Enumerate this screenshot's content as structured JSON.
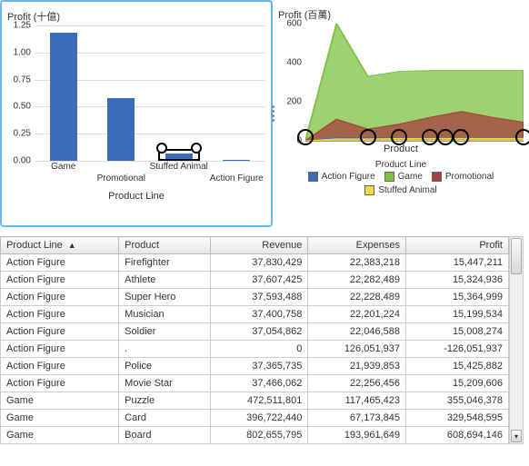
{
  "chart_data": [
    {
      "type": "bar",
      "title": "Profit (十億)",
      "xlabel": "Product Line",
      "ylabel": "",
      "ylim": [
        0,
        1.25
      ],
      "yticks": [
        0.0,
        0.25,
        0.5,
        0.75,
        1.0,
        1.25
      ],
      "categories": [
        "Game",
        "Promotional",
        "Stuffed Animal",
        "Action Figure"
      ],
      "values": [
        1.18,
        0.58,
        0.07,
        0.01
      ],
      "selected_category": "Stuffed Animal"
    },
    {
      "type": "area",
      "title": "Profit (百萬)",
      "xlabel": "Product",
      "ylabel": "",
      "ylim": [
        0,
        600
      ],
      "yticks": [
        0,
        200,
        400,
        600
      ],
      "legend_title": "Product Line",
      "x_points": 8,
      "series": [
        {
          "name": "Action Figure",
          "color": "#3b6cb7",
          "values": [
            0,
            15,
            15,
            15,
            15,
            15,
            15,
            15
          ]
        },
        {
          "name": "Game",
          "color": "#7cc243",
          "values": [
            0,
            620,
            330,
            355,
            360,
            360,
            360,
            360
          ]
        },
        {
          "name": "Promotional",
          "color": "#a63f3f",
          "values": [
            0,
            110,
            60,
            85,
            120,
            150,
            120,
            95
          ]
        },
        {
          "name": "Stuffed Animal",
          "color": "#f2d94a",
          "values": [
            0,
            10,
            10,
            12,
            12,
            12,
            12,
            12
          ]
        }
      ],
      "selection_markers_x": [
        0,
        2,
        3,
        4,
        4.5,
        5,
        7
      ],
      "selection_markers_y": 20
    }
  ],
  "bar_chart": {
    "title": "Profit (十億)",
    "xlabel": "Product Line"
  },
  "area_chart": {
    "title": "Profit (百萬)",
    "xlabel": "Product",
    "legend_title": "Product Line"
  },
  "legend_items": [
    {
      "name": "Action Figure",
      "color": "#3b6cb7"
    },
    {
      "name": "Game",
      "color": "#7cc243"
    },
    {
      "name": "Promotional",
      "color": "#a63f3f"
    },
    {
      "name": "Stuffed Animal",
      "color": "#f2d94a"
    }
  ],
  "table": {
    "columns": [
      "Product Line",
      "Product",
      "Revenue",
      "Expenses",
      "Profit"
    ],
    "sort_column": "Product Line",
    "rows": [
      {
        "line": "Action Figure",
        "product": "Firefighter",
        "rev": "37,830,429",
        "exp": "22,383,218",
        "prof": "15,447,211"
      },
      {
        "line": "Action Figure",
        "product": "Athlete",
        "rev": "37,607,425",
        "exp": "22,282,489",
        "prof": "15,324,936"
      },
      {
        "line": "Action Figure",
        "product": "Super Hero",
        "rev": "37,593,488",
        "exp": "22,228,489",
        "prof": "15,364,999"
      },
      {
        "line": "Action Figure",
        "product": "Musician",
        "rev": "37,400,758",
        "exp": "22,201,224",
        "prof": "15,199,534"
      },
      {
        "line": "Action Figure",
        "product": "Soldier",
        "rev": "37,054,862",
        "exp": "22,046,588",
        "prof": "15,008,274"
      },
      {
        "line": "Action Figure",
        "product": ".",
        "rev": "0",
        "exp": "126,051,937",
        "prof": "-126,051,937"
      },
      {
        "line": "Action Figure",
        "product": "Police",
        "rev": "37,365,735",
        "exp": "21,939,853",
        "prof": "15,425,882"
      },
      {
        "line": "Action Figure",
        "product": "Movie Star",
        "rev": "37,466,062",
        "exp": "22,256,456",
        "prof": "15,209,606"
      },
      {
        "line": "Game",
        "product": "Puzzle",
        "rev": "472,511,801",
        "exp": "117,465,423",
        "prof": "355,046,378"
      },
      {
        "line": "Game",
        "product": "Card",
        "rev": "396,722,440",
        "exp": "67,173,845",
        "prof": "329,548,595"
      },
      {
        "line": "Game",
        "product": "Board",
        "rev": "802,655,795",
        "exp": "193,961,649",
        "prof": "608,694,146"
      }
    ]
  }
}
